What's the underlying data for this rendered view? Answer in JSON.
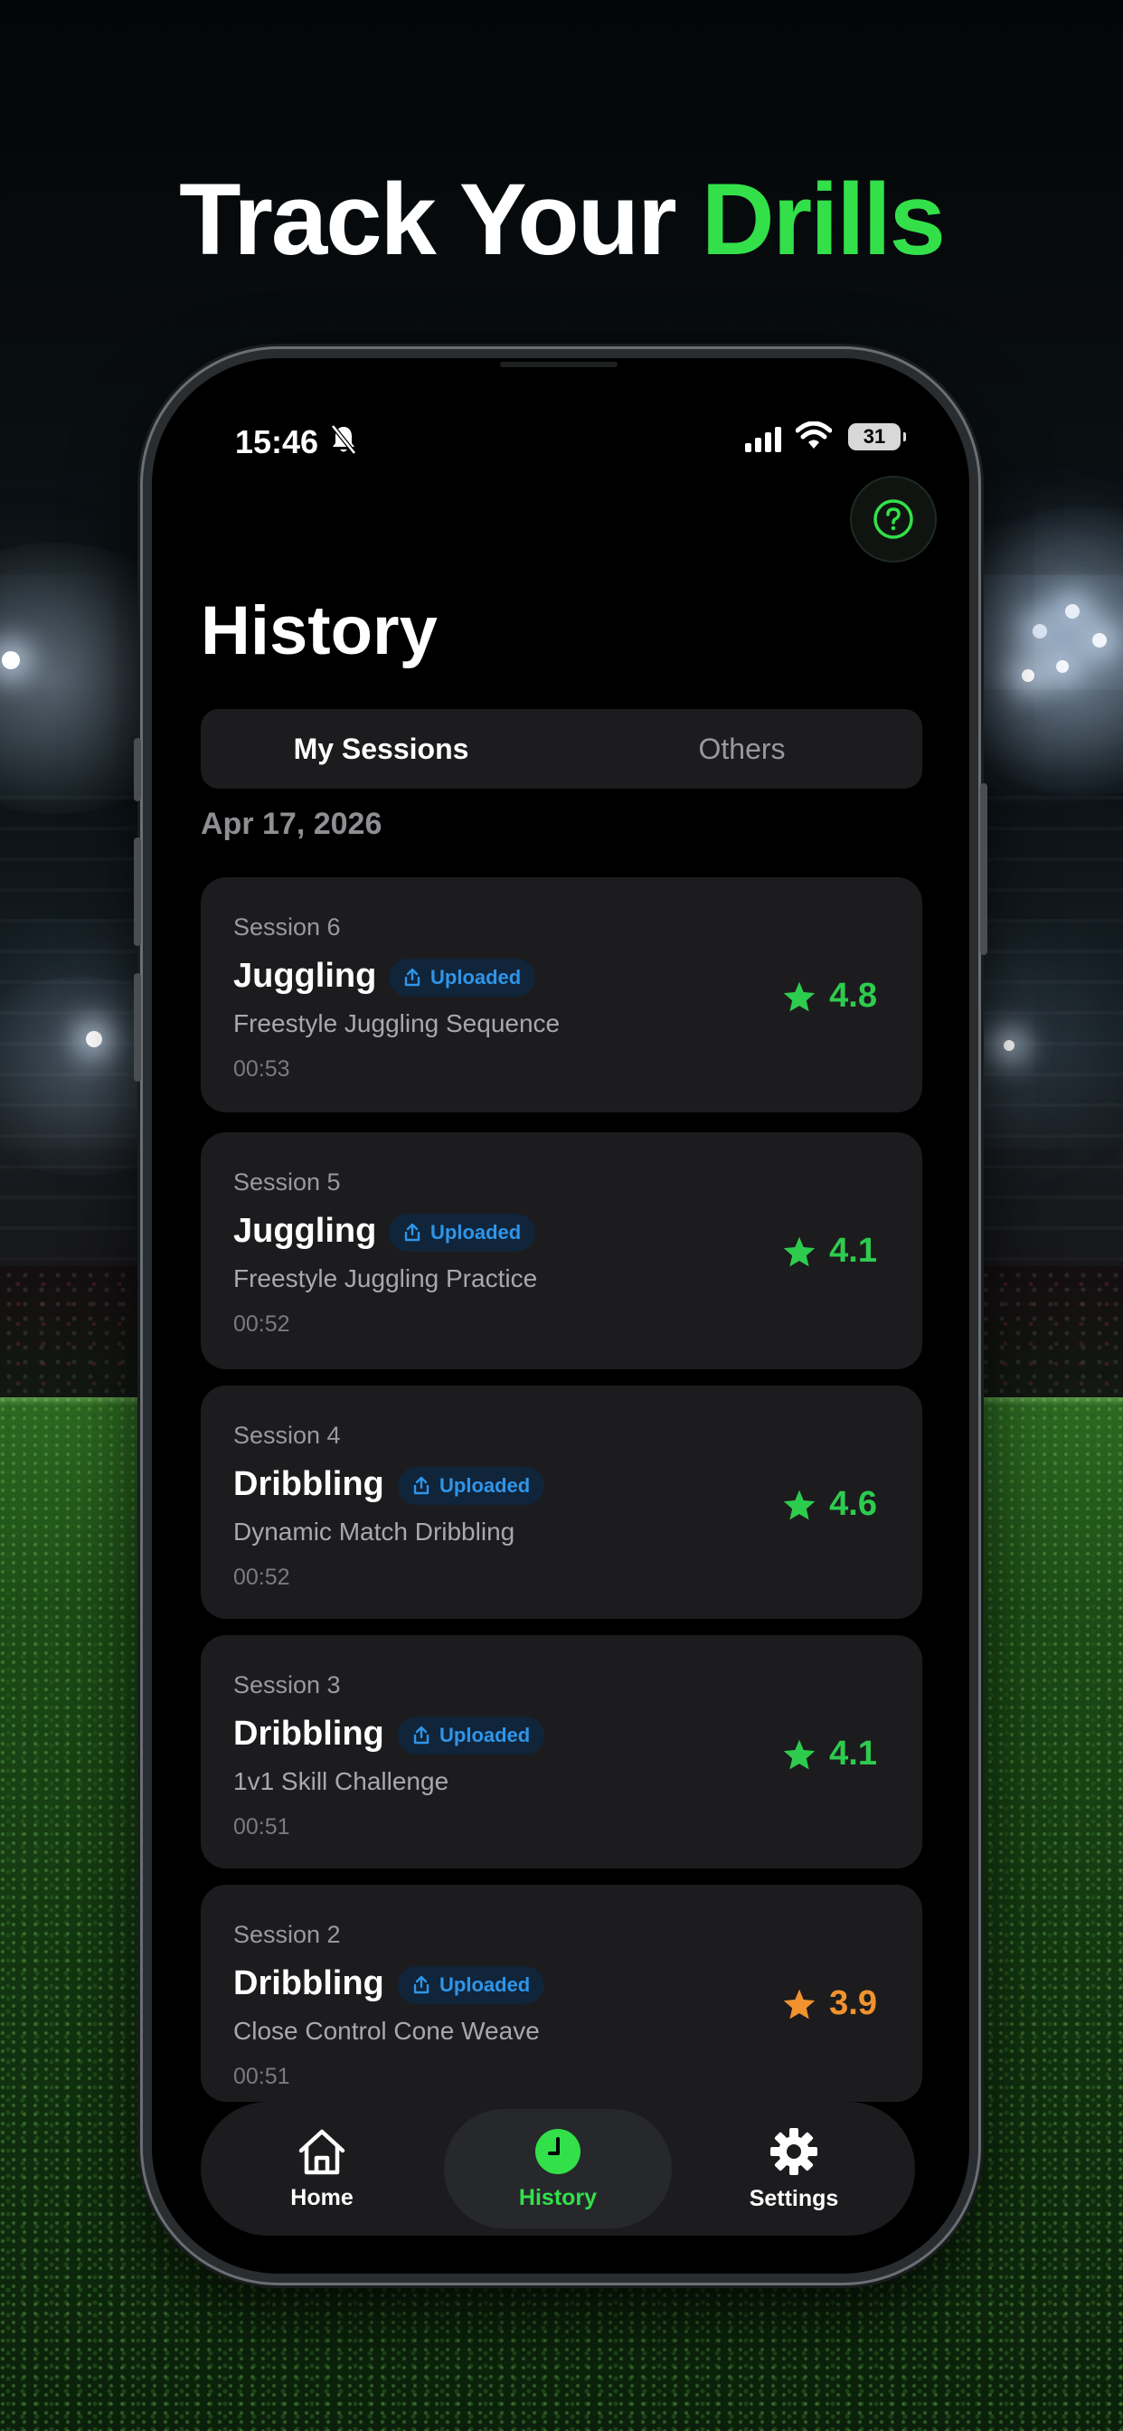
{
  "headline": {
    "part1": "Track Your ",
    "part2": "Drills"
  },
  "status_bar": {
    "time": "15:46",
    "battery": "31"
  },
  "header": {
    "title": "History"
  },
  "segment": {
    "tabs": [
      "My Sessions",
      "Others"
    ],
    "selected": "My Sessions"
  },
  "date_group": "Apr 17, 2026",
  "sessions": [
    {
      "session": "Session 6",
      "title": "Juggling",
      "badge": "Uploaded",
      "description": "Freestyle Juggling Sequence",
      "duration": "00:53",
      "rating": "4.8",
      "rating_color": "#2ecc4e"
    },
    {
      "session": "Session 5",
      "title": "Juggling",
      "badge": "Uploaded",
      "description": "Freestyle Juggling Practice",
      "duration": "00:52",
      "rating": "4.1",
      "rating_color": "#2ecc4e"
    },
    {
      "session": "Session 4",
      "title": "Dribbling",
      "badge": "Uploaded",
      "description": "Dynamic Match Dribbling",
      "duration": "00:52",
      "rating": "4.6",
      "rating_color": "#2ecc4e"
    },
    {
      "session": "Session 3",
      "title": "Dribbling",
      "badge": "Uploaded",
      "description": "1v1 Skill Challenge",
      "duration": "00:51",
      "rating": "4.1",
      "rating_color": "#2ecc4e"
    },
    {
      "session": "Session 2",
      "title": "Dribbling",
      "badge": "Uploaded",
      "description": "Close Control Cone Weave",
      "duration": "00:51",
      "rating": "3.9",
      "rating_color": "#f0922e"
    }
  ],
  "tabbar": {
    "items": [
      {
        "label": "Home",
        "icon": "home-icon"
      },
      {
        "label": "History",
        "icon": "clock-icon"
      },
      {
        "label": "Settings",
        "icon": "gear-icon"
      }
    ],
    "selected": "History"
  },
  "colors": {
    "accent": "#33e04a",
    "badge_text": "#2f95e8",
    "card_bg": "#1c1c1e"
  }
}
